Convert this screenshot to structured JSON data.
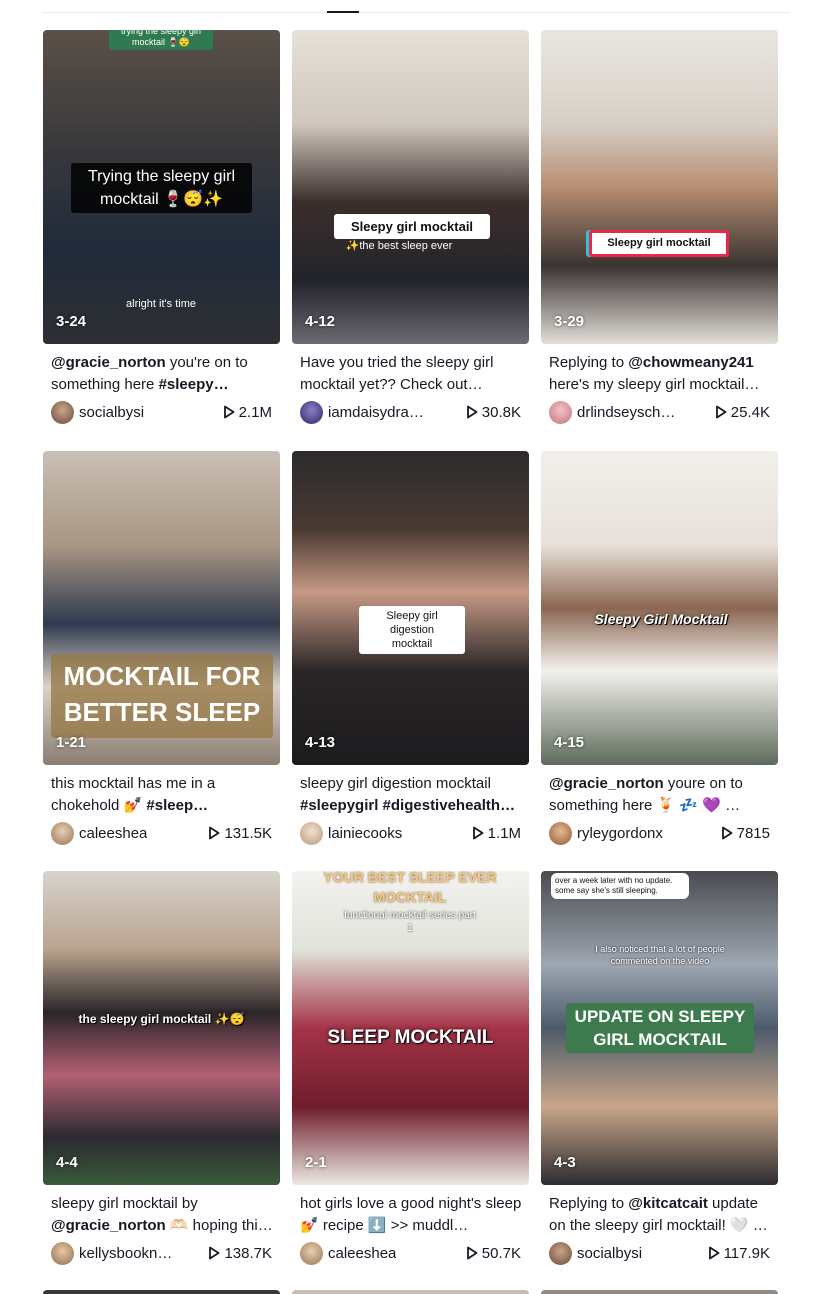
{
  "colors": {
    "text": "#161823",
    "divider": "#e8e8ea"
  },
  "icons": {
    "play": "play-icon"
  },
  "videos": [
    {
      "date": "3-24",
      "caption_mention": "@gracie_norton",
      "caption_text": " you're on to something here ",
      "caption_tag": "#sleepy…",
      "username": "socialbysi",
      "views": "2.1M",
      "overlay_top": "trying the sleepy girl mocktail 🍷😴",
      "overlay_main": "Trying the sleepy girl mocktail 🍷😴✨",
      "overlay_sub": "alright it's time"
    },
    {
      "date": "4-12",
      "caption_text": "Have you tried the sleepy girl mocktail yet?? Check out…",
      "username": "iamdaisydra…",
      "views": "30.8K",
      "overlay_main": "Sleepy girl mocktail",
      "overlay_sub": "✨the best sleep ever"
    },
    {
      "date": "3-29",
      "caption_prefix": "Replying to ",
      "caption_mention": "@chowmeany241",
      "caption_text": " here's my sleepy girl mocktail…",
      "username": "drlindseysch…",
      "views": "25.4K",
      "overlay_main": "Sleepy girl mocktail"
    },
    {
      "date": "1-21",
      "caption_text": "this mocktail has me in a chokehold 💅 ",
      "caption_tag": "#sleep…",
      "username": "caleeshea",
      "views": "131.5K",
      "overlay_main": "MOCKTAIL FOR BETTER SLEEP"
    },
    {
      "date": "4-13",
      "caption_text": "sleepy girl digestion mocktail ",
      "caption_tag": "#sleepygirl #digestivehealth…",
      "username": "lainiecooks",
      "views": "1.1M",
      "overlay_main": "Sleepy girl digestion mocktail"
    },
    {
      "date": "4-15",
      "caption_mention": "@gracie_norton",
      "caption_text": " youre on to something here 🍹 💤 💜 …",
      "username": "ryleygordonx",
      "views": "7815",
      "overlay_main": "Sleepy Girl Mocktail"
    },
    {
      "date": "4-4",
      "caption_text": "sleepy girl mocktail by ",
      "caption_mention": "@gracie_norton",
      "caption_text2": " 🫶🏻 hoping thi…",
      "username": "kellysbookn…",
      "views": "138.7K",
      "overlay_main": "the sleepy girl mocktail ✨😴"
    },
    {
      "date": "2-1",
      "caption_text": "hot girls love a good night's sleep 💅 recipe ⬇️ >> muddl…",
      "username": "caleeshea",
      "views": "50.7K",
      "overlay_top": "YOUR BEST SLEEP EVER MOCKTAIL",
      "overlay_sub": "functional mocktail series part 1",
      "overlay_main": "SLEEP MOCKTAIL"
    },
    {
      "date": "4-3",
      "caption_prefix": "Replying to ",
      "caption_mention": "@kitcatcait",
      "caption_text": " update on the sleepy girl mocktail! 🤍 …",
      "username": "socialbysi",
      "views": "117.9K",
      "overlay_top": "over a week later with no update. some say she's still sleeping.",
      "overlay_sub": "I also noticed that a lot of people commented on the video",
      "overlay_main": "UPDATE ON SLEEPY GIRL MOCKTAIL"
    }
  ]
}
